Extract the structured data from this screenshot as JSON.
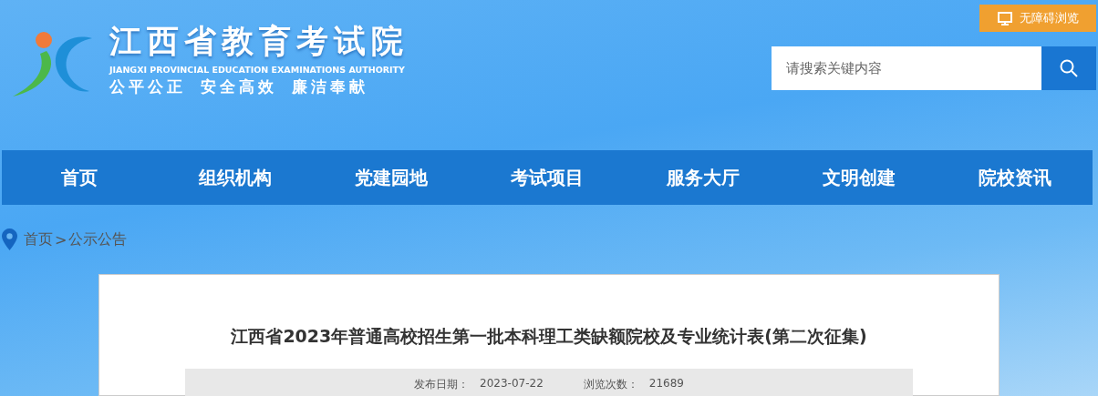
{
  "header": {
    "title": "江西省教育考试院",
    "subtitle": "JIANGXI PROVINCIAL EDUCATION EXAMINATIONS AUTHORITY",
    "motto": [
      "公平公正",
      "安全高效",
      "廉洁奉献"
    ],
    "accessibility_button": "无障碍浏览",
    "search": {
      "placeholder": "请搜索关键内容"
    }
  },
  "nav": [
    {
      "label": "首页"
    },
    {
      "label": "组织机构"
    },
    {
      "label": "党建园地"
    },
    {
      "label": "考试项目"
    },
    {
      "label": "服务大厅"
    },
    {
      "label": "文明创建"
    },
    {
      "label": "院校资讯"
    }
  ],
  "breadcrumb": {
    "home": "首页",
    "separator": ">",
    "current": "公示公告"
  },
  "article": {
    "title": "江西省2023年普通高校招生第一批本科理工类缺额院校及专业统计表(第二次征集)",
    "meta": [
      {
        "label": "发布日期：",
        "value": "2023-07-22"
      },
      {
        "label": "浏览次数：",
        "value": "21689"
      }
    ]
  }
}
